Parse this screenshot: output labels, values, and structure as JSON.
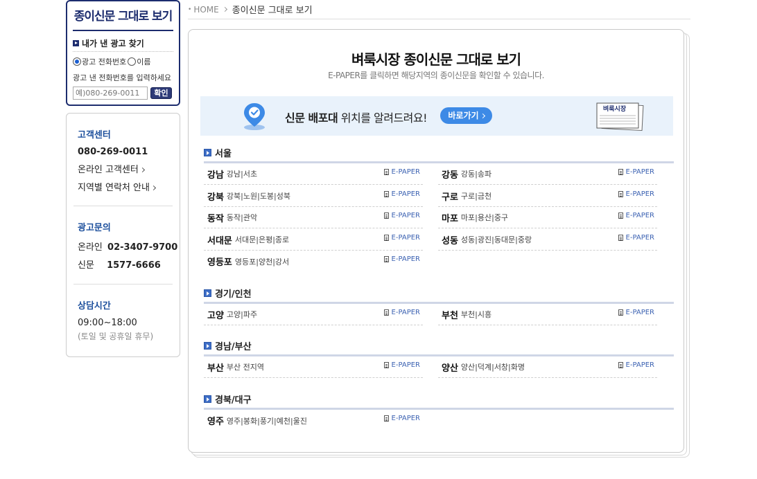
{
  "left": {
    "search": {
      "title": "종이신문 그대로 보기",
      "subtitle": "내가 낸 광고 찾기",
      "radio_phone": "광고 전화번호",
      "radio_name": "이름",
      "hint": "광고 낸 전화번호를 입력하세요",
      "placeholder": "예)080-269-0011",
      "confirm": "확인"
    },
    "info": {
      "cs_title": "고객센터",
      "cs_phone": "080-269-0011",
      "cs_online": "온라인 고객센터",
      "cs_region": "지역별 연락처 안내",
      "ad_title": "광고문의",
      "ad_online_label": "온라인",
      "ad_online_phone": "02-3407-9700",
      "ad_paper_label": "신문",
      "ad_paper_phone": "1577-6666",
      "hours_title": "상담시간",
      "hours": "09:00~18:00",
      "hours_note": "(토일 및 공휴일 휴무)"
    }
  },
  "breadcrumb": {
    "home": "HOME",
    "current": "종이신문 그대로 보기"
  },
  "main": {
    "title": "벼룩시장 종이신문 그대로 보기",
    "subtitle": "E-PAPER를 클릭하면 해당지역의 종이신문을 확인할 수 있습니다.",
    "banner": {
      "text_bold": "신문 배포대",
      "text_rest": " 위치를 알려드려요!",
      "button": "바로가기",
      "paper_label": "벼룩시장"
    },
    "epaper_label": "E-PAPER",
    "regions": [
      {
        "name": "서울",
        "items": [
          {
            "name": "강남",
            "areas": "강남|서초"
          },
          {
            "name": "강동",
            "areas": "강동|송파"
          },
          {
            "name": "강북",
            "areas": "강북|노원|도봉|성북"
          },
          {
            "name": "구로",
            "areas": "구로|금천"
          },
          {
            "name": "동작",
            "areas": "동작|관악"
          },
          {
            "name": "마포",
            "areas": "마포|용산|중구"
          },
          {
            "name": "서대문",
            "areas": "서대문|은평|종로"
          },
          {
            "name": "성동",
            "areas": "성동|광진|동대문|중랑"
          },
          {
            "name": "영등포",
            "areas": "영등포|양천|강서"
          }
        ]
      },
      {
        "name": "경기/인천",
        "items": [
          {
            "name": "고양",
            "areas": "고양|파주"
          },
          {
            "name": "부천",
            "areas": "부천|시흥"
          }
        ]
      },
      {
        "name": "경남/부산",
        "items": [
          {
            "name": "부산",
            "areas": "부산 전지역"
          },
          {
            "name": "양산",
            "areas": "양산|덕계|서창|화명"
          }
        ]
      },
      {
        "name": "경북/대구",
        "items": [
          {
            "name": "영주",
            "areas": "영주|봉화|풍기|예천|울진"
          }
        ]
      }
    ]
  },
  "colors": {
    "navy": "#1c2c6e",
    "accent_blue": "#3d8ae6",
    "link_blue": "#3c62b2",
    "banner_bg": "#e9f2fb"
  }
}
